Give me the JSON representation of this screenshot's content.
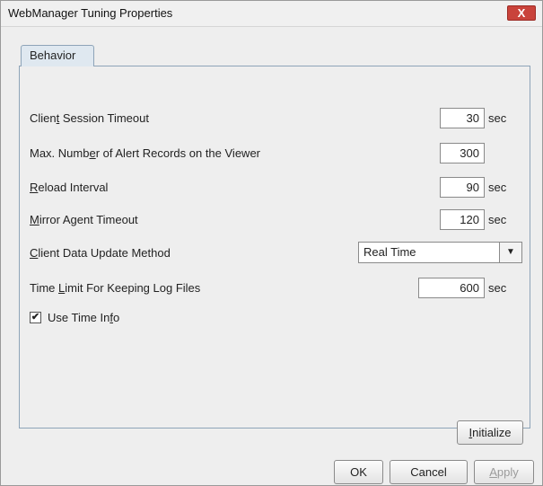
{
  "window": {
    "title": "WebManager Tuning Properties",
    "close_label": "X"
  },
  "tabs": [
    {
      "label": "Behavior"
    }
  ],
  "fields": {
    "client_session_timeout": {
      "label_pre": "Clien",
      "mnemonic": "t",
      "label_post": " Session Timeout",
      "value": "30",
      "unit": "sec"
    },
    "max_alert_records": {
      "label_pre": "Max. Numb",
      "mnemonic": "e",
      "label_post": "r of Alert Records on the Viewer",
      "value": "300"
    },
    "reload_interval": {
      "label_pre": "",
      "mnemonic": "R",
      "label_post": "eload Interval",
      "value": "90",
      "unit": "sec"
    },
    "mirror_agent_timeout": {
      "label_pre": "",
      "mnemonic": "M",
      "label_post": "irror Agent Timeout",
      "value": "120",
      "unit": "sec"
    },
    "client_data_update_method": {
      "label_pre": "",
      "mnemonic": "C",
      "label_post": "lient Data Update Method",
      "selected": "Real Time"
    },
    "log_time_limit": {
      "label_pre": "Time ",
      "mnemonic": "L",
      "label_post": "imit For Keeping Log Files",
      "value": "600",
      "unit": "sec"
    },
    "use_time_info": {
      "label_pre": "Use Time In",
      "mnemonic": "f",
      "label_post": "o",
      "checked": true,
      "check_mark": "✔"
    }
  },
  "buttons": {
    "initialize": {
      "mnemonic": "I",
      "label_post": "nitialize"
    },
    "ok": "OK",
    "cancel": "Cancel",
    "apply": {
      "mnemonic": "A",
      "label_post": "pply",
      "disabled": true
    }
  }
}
